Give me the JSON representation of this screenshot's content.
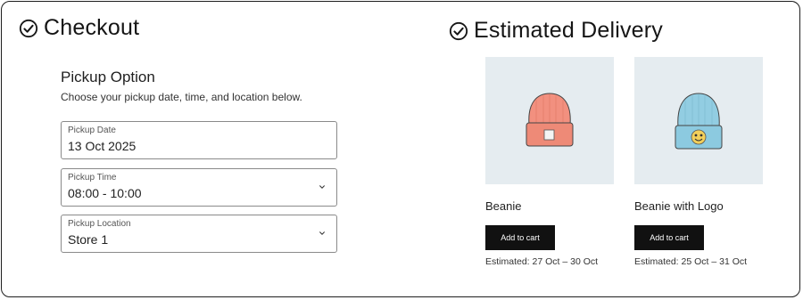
{
  "checkout": {
    "heading": "Checkout",
    "pickup": {
      "title": "Pickup Option",
      "description": "Choose your pickup date, time, and location below.",
      "date": {
        "label": "Pickup Date",
        "value": "13 Oct 2025"
      },
      "time": {
        "label": "Pickup Time",
        "value": "08:00 - 10:00"
      },
      "location": {
        "label": "Pickup Location",
        "value": "Store 1"
      }
    }
  },
  "delivery": {
    "heading": "Estimated Delivery",
    "products": [
      {
        "name": "Beanie",
        "button": "Add to cart",
        "estimate": "Estimated: 27 Oct – 30 Oct",
        "color": "#f08a78",
        "icon": "beanie-image"
      },
      {
        "name": "Beanie with Logo",
        "button": "Add to cart",
        "estimate": "Estimated: 25 Oct – 31 Oct",
        "color": "#8fcbe0",
        "icon": "beanie-with-logo-image"
      }
    ]
  }
}
